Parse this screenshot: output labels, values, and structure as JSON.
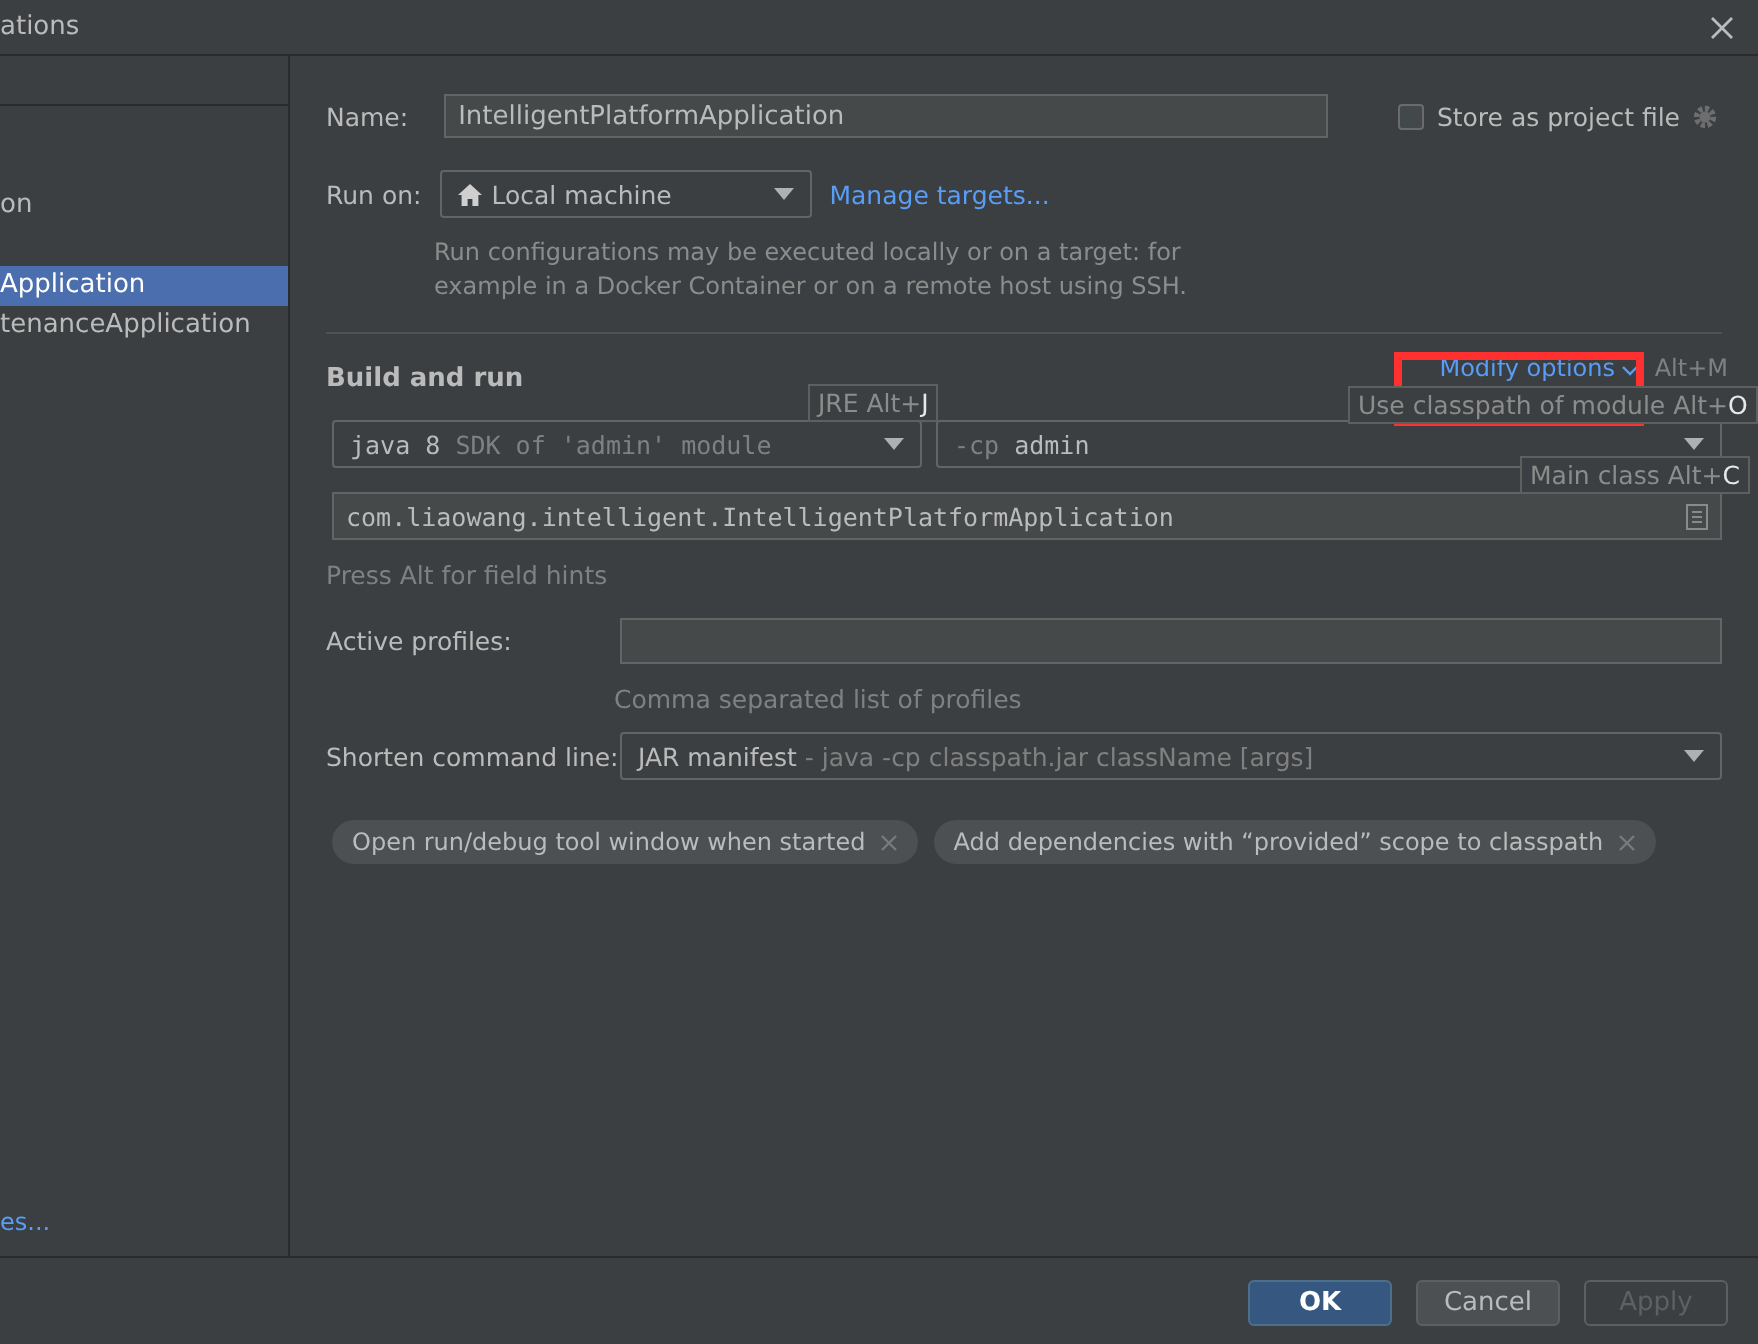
{
  "window": {
    "title": "ations"
  },
  "sidebar": {
    "items": [
      {
        "label": "on",
        "selected": false
      },
      {
        "label": "Application",
        "selected": true
      },
      {
        "label": "tenanceApplication",
        "selected": false
      }
    ],
    "link": "es..."
  },
  "name": {
    "label": "Name:",
    "value": "IntelligentPlatformApplication"
  },
  "store_as_project_file": {
    "label": "Store as project file",
    "checked": false
  },
  "run_on": {
    "label": "Run on:",
    "value": "Local machine",
    "link": "Manage targets...",
    "description": "Run configurations may be executed locally or on a target: for example in a Docker Container or on a remote host using SSH."
  },
  "build_and_run": {
    "title": "Build and run",
    "modify_options": "Modify options",
    "modify_shortcut": "Alt+M",
    "jre": {
      "value": "java 8",
      "hint": "SDK of 'admin' module"
    },
    "classpath": {
      "prefix": "-cp",
      "value": "admin"
    },
    "main_class": "com.liaowang.intelligent.IntelligentPlatformApplication",
    "hints": [
      {
        "label": "JRE Alt+",
        "key": "J"
      },
      {
        "label": "Use classpath of module Alt+",
        "key": "O"
      },
      {
        "label": "Main class Alt+",
        "key": "C"
      }
    ],
    "field_hint": "Press Alt for field hints"
  },
  "active_profiles": {
    "label": "Active profiles:",
    "hint": "Comma separated list of profiles"
  },
  "shorten_command_line": {
    "label": "Shorten command line:",
    "value": "JAR manifest",
    "detail": "- java -cp classpath.jar className [args]"
  },
  "options": [
    "Open run/debug tool window when started",
    "Add dependencies with “provided” scope to classpath"
  ],
  "buttons": [
    {
      "label": "OK",
      "kind": "primary"
    },
    {
      "label": "Cancel",
      "kind": "normal"
    },
    {
      "label": "Apply",
      "kind": "disabled"
    }
  ]
}
